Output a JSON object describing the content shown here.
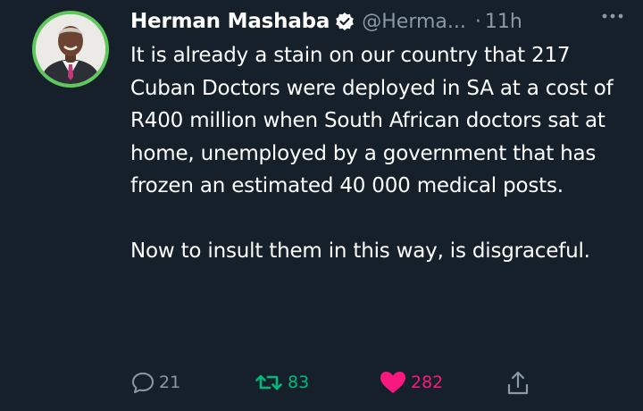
{
  "tweet": {
    "author_name": "Herman Mashaba",
    "handle": "@Herma...",
    "separator": "·",
    "time": "11h",
    "paragraph1": "It is already a stain on our country that 217 Cuban Doctors were deployed in SA at a cost of R400 million when South African doctors sat at home, unemployed by a government that has frozen an estimated 40 000 medical posts.",
    "paragraph2": "Now to insult them in this way, is disgraceful.",
    "replies": "21",
    "retweets": "83",
    "likes": "282"
  },
  "icons": {
    "verified": "verified-badge-icon",
    "more": "more-horizontal-icon",
    "reply": "reply-icon",
    "retweet": "retweet-icon",
    "like": "heart-icon",
    "share": "share-icon"
  },
  "colors": {
    "background": "#15202b",
    "secondary_text": "#8b98a5",
    "retweet_active": "#00ba7c",
    "like_active": "#f91880",
    "avatar_ring": "#5fc85a"
  }
}
